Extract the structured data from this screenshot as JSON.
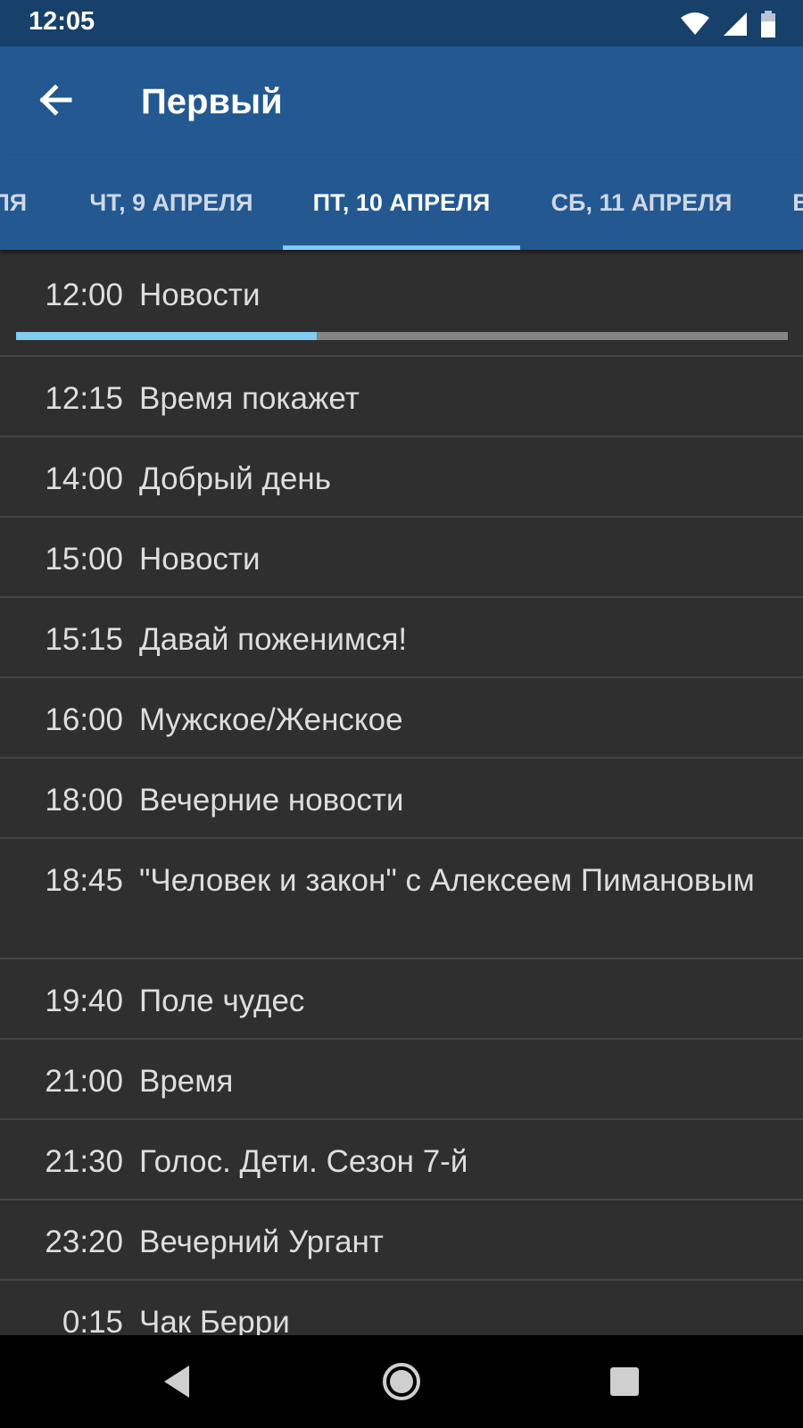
{
  "status_bar": {
    "time": "12:05",
    "icons": [
      "wifi-icon",
      "signal-icon",
      "battery-icon"
    ]
  },
  "app_bar": {
    "title": "Первый",
    "back_icon": "arrow-back-icon"
  },
  "tabs": [
    {
      "label": "ЛЯ"
    },
    {
      "label": "ЧТ, 9 АПРЕЛЯ"
    },
    {
      "label": "ПТ, 10 АПРЕЛЯ",
      "active": true
    },
    {
      "label": "СБ, 11 АПРЕЛЯ"
    },
    {
      "label": "В"
    }
  ],
  "current_program_progress": 0.39,
  "programs": [
    {
      "time": "12:00",
      "name": "Новости"
    },
    {
      "time": "12:15",
      "name": "Время покажет"
    },
    {
      "time": "14:00",
      "name": "Добрый день"
    },
    {
      "time": "15:00",
      "name": "Новости"
    },
    {
      "time": "15:15",
      "name": "Давай поженимся!"
    },
    {
      "time": "16:00",
      "name": "Мужское/Женское"
    },
    {
      "time": "18:00",
      "name": "Вечерние новости"
    },
    {
      "time": "18:45",
      "name": "\"Человек и закон\" с Алексеем Пимановым"
    },
    {
      "time": "19:40",
      "name": "Поле чудес"
    },
    {
      "time": "21:00",
      "name": "Время"
    },
    {
      "time": "21:30",
      "name": "Голос. Дети. Сезон 7-й"
    },
    {
      "time": "23:20",
      "name": "Вечерний Ургант"
    },
    {
      "time": "0:15",
      "name": "Чак Берри"
    }
  ],
  "nav_bar": [
    "back-triangle-icon",
    "home-circle-icon",
    "recents-square-icon"
  ],
  "colors": {
    "status_bar": "#17406b",
    "app_bar": "#235891",
    "accent": "#7fcaf2",
    "background": "#2f2f2f"
  }
}
